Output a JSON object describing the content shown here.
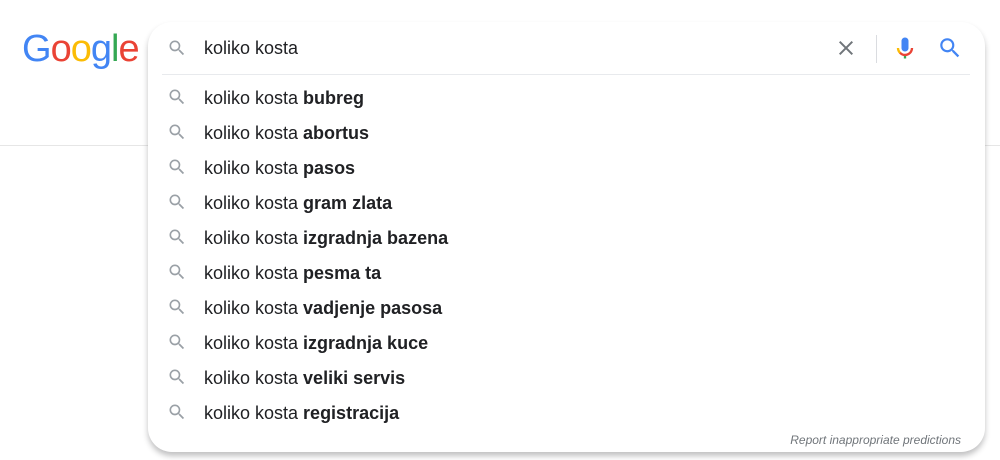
{
  "logo": {
    "letters": [
      "G",
      "o",
      "o",
      "g",
      "l",
      "e"
    ],
    "colors": [
      "#4285F4",
      "#EA4335",
      "#FBBC05",
      "#4285F4",
      "#34A853",
      "#EA4335"
    ]
  },
  "search": {
    "value": "koliko kosta",
    "icon": "search-icon",
    "clear_icon": "close-icon",
    "mic_icon": "mic-icon",
    "submit_icon": "search-icon"
  },
  "suggestions": [
    {
      "prefix": "koliko kosta ",
      "completion": "bubreg"
    },
    {
      "prefix": "koliko kosta ",
      "completion": "abortus"
    },
    {
      "prefix": "koliko kosta ",
      "completion": "pasos"
    },
    {
      "prefix": "koliko kosta ",
      "completion": "gram zlata"
    },
    {
      "prefix": "koliko kosta ",
      "completion": "izgradnja bazena"
    },
    {
      "prefix": "koliko kosta ",
      "completion": "pesma ta"
    },
    {
      "prefix": "koliko kosta ",
      "completion": "vadjenje pasosa"
    },
    {
      "prefix": "koliko kosta ",
      "completion": "izgradnja kuce"
    },
    {
      "prefix": "koliko kosta ",
      "completion": "veliki servis"
    },
    {
      "prefix": "koliko kosta ",
      "completion": "registracija"
    }
  ],
  "footer": {
    "report_label": "Report inappropriate predictions"
  },
  "colors": {
    "text": "#202124",
    "icon_gray": "#9aa0a6",
    "accent_blue": "#4285F4"
  }
}
